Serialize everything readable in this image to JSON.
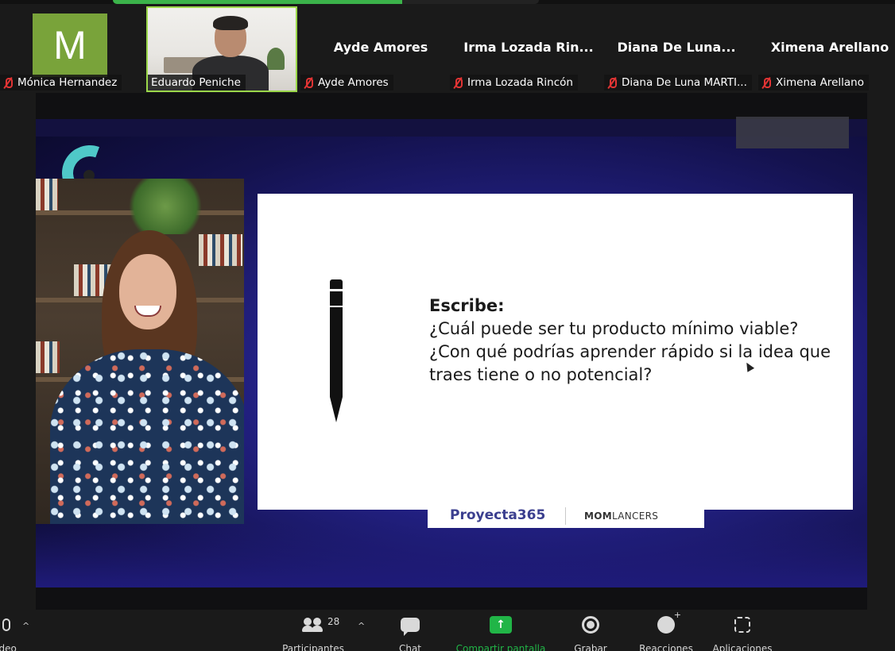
{
  "participants": [
    {
      "name": "Mónica Hernandez",
      "initial": "M",
      "muted": true
    },
    {
      "name": "Eduardo Peniche",
      "muted": false,
      "video": true
    },
    {
      "name": "Ayde Amores",
      "big_name": "Ayde Amores",
      "muted": true
    },
    {
      "name": "Irma Lozada Rincón",
      "big_name": "Irma Lozada Rin...",
      "muted": true
    },
    {
      "name": "Diana De Luna MARTI...",
      "big_name": "Diana De Luna...",
      "muted": true
    },
    {
      "name": "Ximena Arellano",
      "big_name": "Ximena Arellano",
      "muted": true
    }
  ],
  "slide": {
    "heading": "Escribe:",
    "line1": "¿Cuál puede ser tu producto mínimo viable?",
    "line2": "¿Con qué podrías aprender rápido si la idea que traes tiene o no potencial?"
  },
  "brands": {
    "proyecta": "Proyecta365",
    "momlancers_prefix": "MOM",
    "momlancers_suffix": "LANCERS"
  },
  "toolbar": {
    "video_label": "ideo",
    "participants_label": "Participantes",
    "participants_count": "28",
    "chat_label": "Chat",
    "share_label": "Compartir pantalla",
    "record_label": "Grabar",
    "reactions_label": "Reacciones",
    "apps_label": "Aplicaciones",
    "caret": "^"
  },
  "colors": {
    "accent_green": "#21b547",
    "avatar_bg": "#79a33a",
    "active_border": "#9bd84a",
    "muted_red": "#e23434"
  }
}
